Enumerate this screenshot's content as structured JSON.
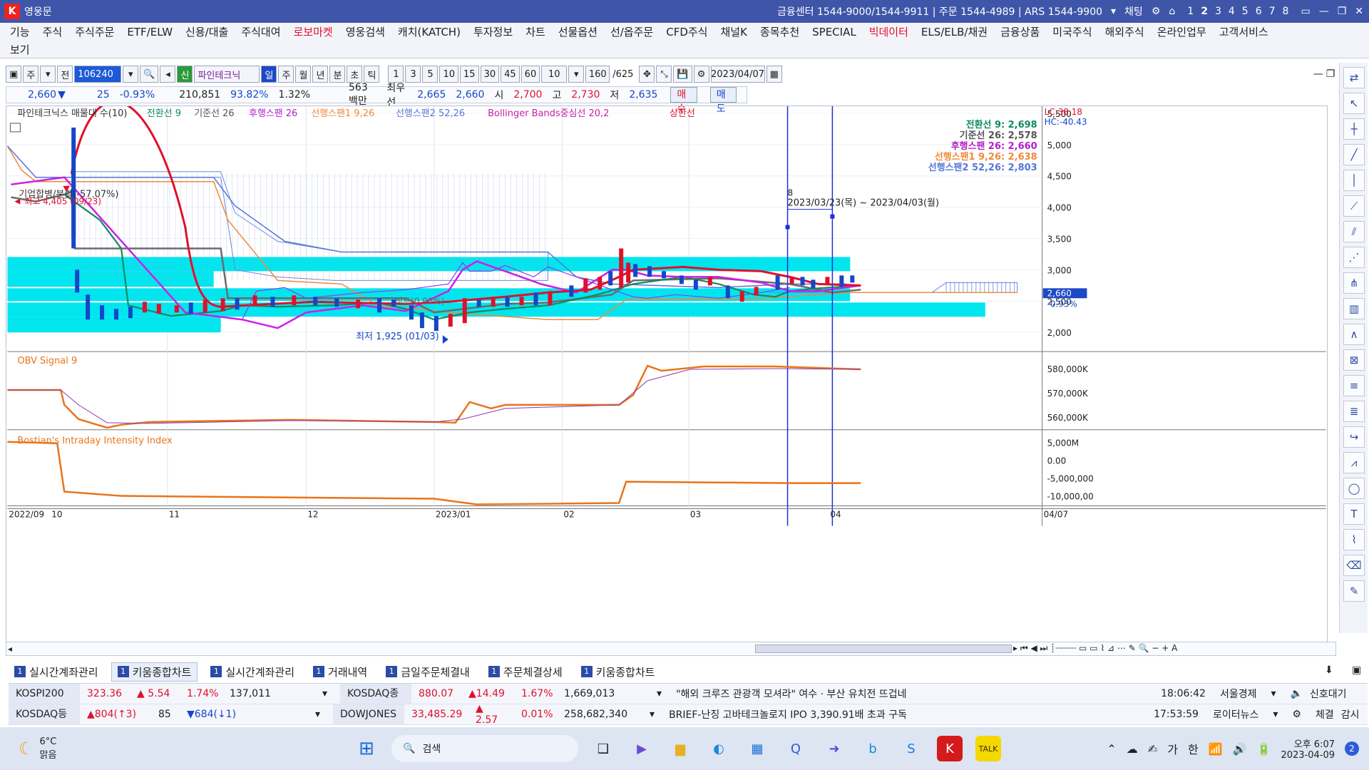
{
  "app": {
    "title": "영웅문",
    "right_info": "금융센터 1544-9000/1544-9911 | 주문 1544-4989 | ARS 1544-9900",
    "chat": "채팅",
    "screen_nums": [
      "1",
      "2",
      "3",
      "4",
      "5",
      "6",
      "7",
      "8"
    ]
  },
  "menu": {
    "row1": [
      "기능",
      "주식",
      "주식주문",
      "ETF/ELW",
      "신용/대출",
      "주식대여",
      "로보마켓",
      "영웅검색",
      "캐치(KATCH)",
      "투자정보",
      "차트",
      "선물옵션",
      "선/옵주문",
      "CFD주식",
      "채널K",
      "종목추천",
      "SPECIAL",
      "빅데이터",
      "ELS/ELB/채권",
      "금융상품",
      "미국주식",
      "해외주식",
      "온라인업무",
      "고객서비스"
    ],
    "row1_red": [
      "로보마켓",
      "빅데이터"
    ],
    "row2": [
      "보기"
    ]
  },
  "toolbar": {
    "mode1": "주",
    "mode2": "전",
    "code": "106240",
    "tag": "신",
    "stock_name": "파인테크닉",
    "periods": [
      "일",
      "주",
      "월",
      "년",
      "분",
      "초",
      "틱"
    ],
    "selected_period": "일",
    "intervals": [
      "1",
      "3",
      "5",
      "10",
      "15",
      "30",
      "45",
      "60"
    ],
    "interval_val": "10",
    "count": "160",
    "total": "/625",
    "date": "2023/04/07"
  },
  "quote": {
    "price": "2,660",
    "change": "25",
    "pct": "-0.93%",
    "volume": "210,851",
    "vol_ratio": "93.82%",
    "turnover": "1.32%",
    "amount": "563백만",
    "best_ask_label": "최우선",
    "best_ask": "2,665",
    "best_bid": "2,660",
    "open_label": "시",
    "open": "2,700",
    "high_label": "고",
    "high": "2,730",
    "low_label": "저",
    "low": "2,635",
    "buy": "매수",
    "sell": "매도"
  },
  "indicators": {
    "main_legend": [
      "파인테크닉스 매물대 수(10)",
      "전환선 9",
      "기준선 26",
      "후행스팬 26",
      "선행스팬1 9,26",
      "선행스팬2 52,26",
      "Bollinger Bands중심선 20,2",
      "상한선"
    ],
    "values": [
      {
        "label": "전환선  9: 2,698",
        "color": "#118a5e"
      },
      {
        "label": "기준선  26: 2,578",
        "color": "#555555"
      },
      {
        "label": "후행스팬  26: 2,660",
        "color": "#b21fcb"
      },
      {
        "label": "선행스팬1 9,26: 2,638",
        "color": "#f08a3a"
      },
      {
        "label": "선행스팬2 52,26: 2,803",
        "color": "#5477d8"
      }
    ],
    "lc": "LC:38.18",
    "hc": "HC:-40.43",
    "merger_note": "기업합병/분할(-57.07%)",
    "high_note": "최고 4,405 (09/23)",
    "low_note": "최저 1,925 (01/03)",
    "mid_note": "비트(0.06%)",
    "range_count": "8",
    "range_note": "2023/03/23(목) ~ 2023/04/03(월)",
    "price_tag": "2,660",
    "price_tag_pct": "-0.93%",
    "obv_title": "OBV  Signal 9",
    "bii_title": "Bostian's Intraday Intensity Index"
  },
  "chart_data": {
    "type": "line",
    "title": "파인테크닉스",
    "price_axis": [
      "5,500",
      "5,000",
      "4,500",
      "4,000",
      "3,500",
      "3,000",
      "2,500",
      "2,000"
    ],
    "obv_axis": [
      "580,000K",
      "570,000K",
      "560,000K"
    ],
    "bii_axis": [
      "5,000M",
      "0.00",
      "-5,000,000",
      "-10,000,00"
    ],
    "x_labels": [
      "2022/09",
      "10",
      "11",
      "12",
      "2023/01",
      "02",
      "03",
      "04",
      "04/07"
    ],
    "x": [
      "2022/09",
      "2022/10",
      "2022/11",
      "2022/12",
      "2023/01",
      "2023/02",
      "2023/03",
      "2023/04"
    ],
    "series": [
      {
        "name": "기준선",
        "values": [
          4300,
          3300,
          2500,
          2500,
          2450,
          2600,
          2800,
          2580
        ]
      },
      {
        "name": "전환선",
        "values": [
          4100,
          2500,
          2500,
          2500,
          2250,
          2750,
          2700,
          2698
        ]
      },
      {
        "name": "후행스팬",
        "values": [
          4400,
          3100,
          2300,
          2600,
          2400,
          2850,
          2600,
          2660
        ]
      },
      {
        "name": "Bollinger Bands중심선",
        "values": [
          4500,
          5500,
          2600,
          2600,
          2500,
          2800,
          2900,
          2700
        ]
      }
    ],
    "obv": [
      574000,
      561000,
      564000,
      563000,
      567000,
      580000,
      579000,
      578000
    ],
    "bii": [
      5000,
      -9000,
      -9500,
      -9500,
      -10500,
      -7000,
      -7200,
      -7000
    ]
  },
  "tabs": [
    {
      "n": "1",
      "label": "실시간계좌관리",
      "active": false
    },
    {
      "n": "1",
      "label": "키움종합차트",
      "active": true
    },
    {
      "n": "1",
      "label": "실시간계좌관리",
      "active": false
    },
    {
      "n": "1",
      "label": "거래내역",
      "active": false
    },
    {
      "n": "1",
      "label": "금일주문체결내",
      "active": false
    },
    {
      "n": "1",
      "label": "주문체결상세",
      "active": false
    },
    {
      "n": "1",
      "label": "키움종합차트",
      "active": false
    }
  ],
  "ticker": {
    "kospi": {
      "name": "KOSPI200",
      "price": "323.36",
      "chg": "▲ 5.54",
      "pct": "1.74%",
      "vol": "137,011"
    },
    "kosdaq": {
      "name": "KOSDAQ종합",
      "price": "880.07",
      "chg": "▲14.49",
      "pct": "1.67%",
      "vol": "1,669,013"
    },
    "news1": "\"해외 크루즈 관광객 모셔라\" 여수 · 부산 유치전 뜨겁네",
    "news1_time": "18:06:42",
    "news1_src": "서울경제",
    "signal": "신호대기",
    "kosdaq_up": {
      "name": "KOSDAQ등락",
      "up": "▲804(↑3)",
      "flat": "85",
      "down": "▼684(↓1)"
    },
    "dow": {
      "name": "DOWJONES",
      "price": "33,485.29",
      "chg": "▲ 2.57",
      "pct": "0.01%",
      "vol": "258,682,340"
    },
    "news2": "BRIEF-난징 고바테크놀로지 IPO 3,390.91배 초과 구독",
    "news2_time": "17:53:59",
    "news2_src": "로이터뉴스",
    "settle": "체결",
    "watch": "감시"
  },
  "taskbar": {
    "weather_temp": "6°C",
    "weather_desc": "맑음",
    "search": "검색",
    "ime1": "가",
    "ime2": "한",
    "time": "오후 6:07",
    "date": "2023-04-09",
    "notif": "2"
  }
}
